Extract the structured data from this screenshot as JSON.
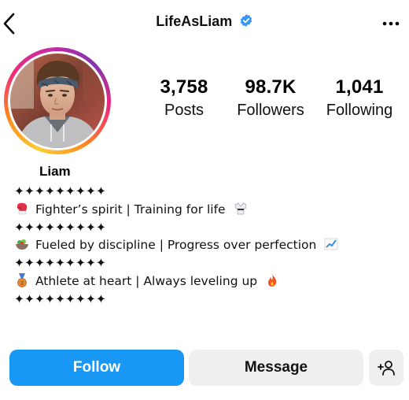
{
  "header": {
    "username": "LifeAsLiam",
    "verified": true,
    "icons": [
      "back-chevron-icon",
      "verified-badge-icon",
      "more-horizontal-icon"
    ]
  },
  "profile": {
    "display_name": "Liam",
    "stats": [
      {
        "value": "3,758",
        "label": "Posts"
      },
      {
        "value": "98.7K",
        "label": "Followers"
      },
      {
        "value": "1,041",
        "label": "Following"
      }
    ]
  },
  "bio": {
    "divider": "✦✦✦✦✦✦✦✦✦",
    "lines": [
      {
        "icon": "boxing-glove-icon",
        "text": "Fighter’s spirit | Training for life",
        "trail_icon": "martial-arts-uniform-icon"
      },
      {
        "icon": "salad-bowl-icon",
        "text": "Fueled by discipline | Progress over perfection",
        "trail_icon": "chart-increasing-icon"
      },
      {
        "icon": "medal-icon",
        "text": "Athlete at heart | Always leveling up",
        "trail_icon": "fire-icon"
      }
    ]
  },
  "actions": {
    "follow_label": "Follow",
    "message_label": "Message",
    "add_user_icon": "add-user-icon"
  },
  "colors": {
    "follow_blue": "#1897f5",
    "secondary_button": "#efefef",
    "verified_blue": "#3897f0"
  }
}
